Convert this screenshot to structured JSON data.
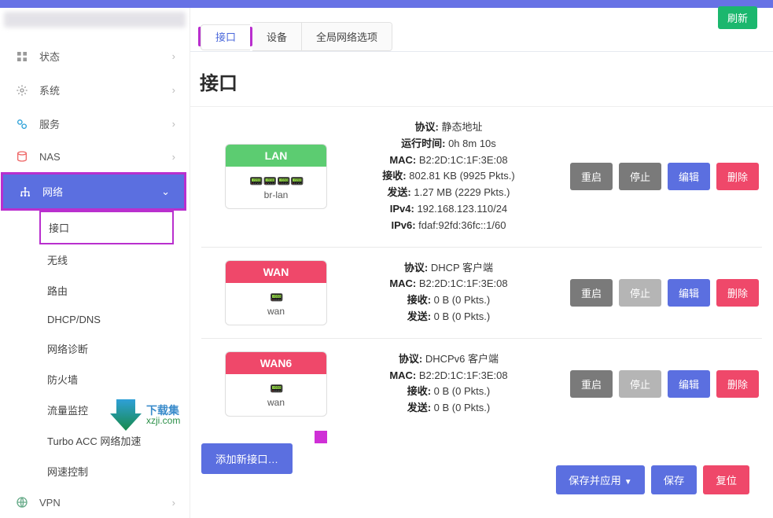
{
  "top": {
    "refresh": "刷新"
  },
  "sidebar": {
    "items": [
      {
        "label": "状态"
      },
      {
        "label": "系统"
      },
      {
        "label": "服务"
      },
      {
        "label": "NAS"
      },
      {
        "label": "网络"
      },
      {
        "label": "VPN"
      }
    ],
    "sub_network": [
      {
        "label": "接口"
      },
      {
        "label": "无线"
      },
      {
        "label": "路由"
      },
      {
        "label": "DHCP/DNS"
      },
      {
        "label": "网络诊断"
      },
      {
        "label": "防火墙"
      },
      {
        "label": "流量监控"
      },
      {
        "label": "Turbo ACC 网络加速"
      },
      {
        "label": "网速控制"
      }
    ]
  },
  "tabs": [
    {
      "label": "接口"
    },
    {
      "label": "设备"
    },
    {
      "label": "全局网络选项"
    }
  ],
  "page_title": "接口",
  "labels": {
    "protocol": "协议:",
    "uptime": "运行时间:",
    "mac": "MAC:",
    "rx": "接收:",
    "tx": "发送:",
    "ipv4": "IPv4:",
    "ipv6": "IPv6:"
  },
  "interfaces": [
    {
      "name_upper": "LAN",
      "device": "br-lan",
      "head_class": "green",
      "proto": "静态地址",
      "uptime": "0h 8m 10s",
      "mac": "B2:2D:1C:1F:3E:08",
      "rx": "802.81 KB (9925 Pkts.)",
      "tx": "1.27 MB (2229 Pkts.)",
      "ipv4": "192.168.123.110/24",
      "ipv6": "fdaf:92fd:36fc::1/60",
      "stop_enabled": true
    },
    {
      "name_upper": "WAN",
      "device": "wan",
      "head_class": "red",
      "proto": "DHCP 客户端",
      "mac": "B2:2D:1C:1F:3E:08",
      "rx": "0 B (0 Pkts.)",
      "tx": "0 B (0 Pkts.)",
      "stop_enabled": false
    },
    {
      "name_upper": "WAN6",
      "device": "wan",
      "head_class": "red",
      "proto": "DHCPv6 客户端",
      "mac": "B2:2D:1C:1F:3E:08",
      "rx": "0 B (0 Pkts.)",
      "tx": "0 B (0 Pkts.)",
      "stop_enabled": false
    }
  ],
  "row_buttons": {
    "restart": "重启",
    "stop": "停止",
    "edit": "编辑",
    "delete": "删除"
  },
  "add_button": "添加新接口…",
  "footer": {
    "save_apply": "保存并应用",
    "save": "保存",
    "reset": "复位"
  },
  "watermark": {
    "line1": "下载集",
    "line2": "xzji.com"
  }
}
